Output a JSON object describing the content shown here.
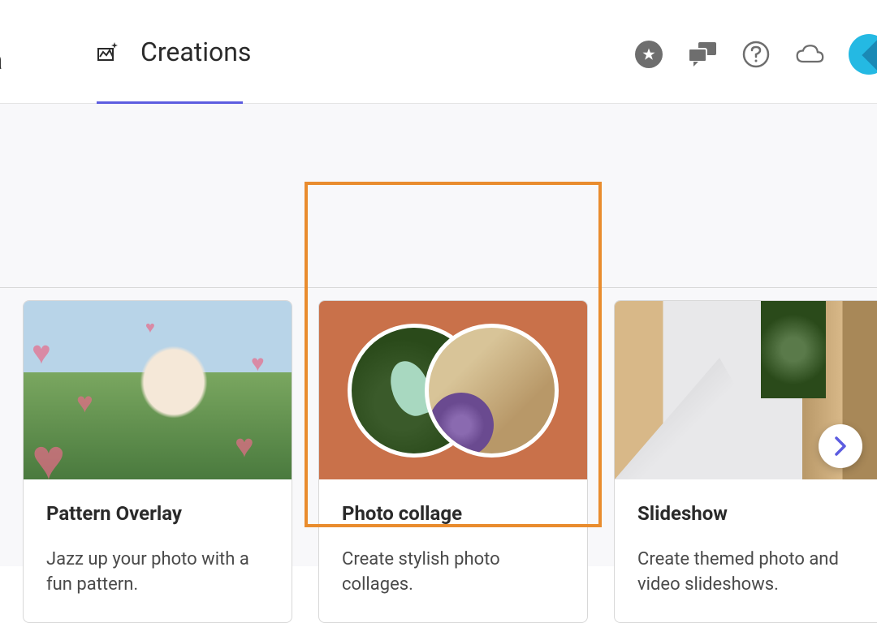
{
  "header": {
    "tabs": {
      "media_partial": "dia",
      "creations": "Creations"
    }
  },
  "cards": [
    {
      "title": "Pattern Overlay",
      "desc": "Jazz up your photo with a fun pattern."
    },
    {
      "title": "Photo collage",
      "desc": "Create stylish photo collages."
    },
    {
      "title": "Slideshow",
      "desc": "Create themed photo and video slideshows."
    }
  ]
}
